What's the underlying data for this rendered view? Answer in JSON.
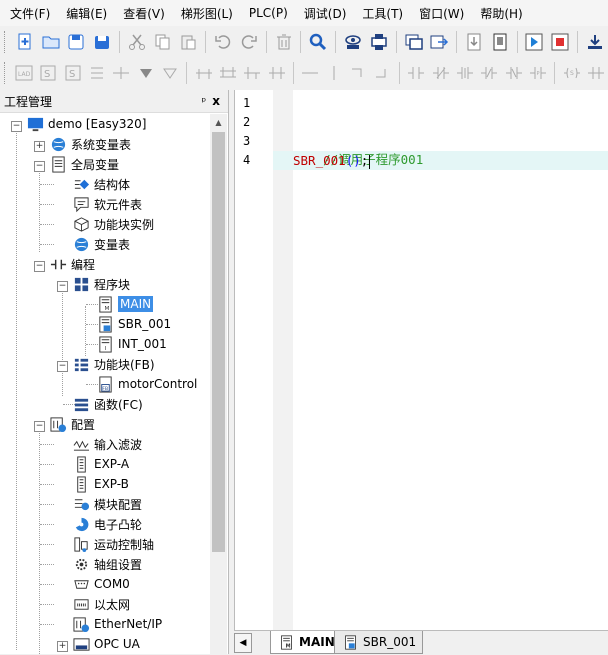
{
  "menu": [
    "文件(F)",
    "编辑(E)",
    "查看(V)",
    "梯形图(L)",
    "PLC(P)",
    "调试(D)",
    "工具(T)",
    "窗口(W)",
    "帮助(H)"
  ],
  "toolbar1": [
    "new-file-icon",
    "open-folder-icon",
    "save-icon",
    "save-all-icon",
    "cut-icon",
    "copy-icon",
    "paste-icon",
    "undo-icon",
    "redo-icon",
    "delete-icon",
    "find-icon",
    "monitor-icon",
    "compile-icon",
    "window-icon",
    "export-icon",
    "download-icon",
    "upload-icon",
    "run-icon",
    "stop-icon",
    "transfer-icon"
  ],
  "toolbar2": [
    "lad-icon",
    "stl-icon",
    "sfc-icon",
    "contact-icon",
    "coil-icon",
    "branch-icon",
    "ladder-elements-icon"
  ],
  "project_panel": {
    "title": "工程管理",
    "pin": "ᵖ",
    "close": "x",
    "tree": {
      "root": "demo [Easy320]",
      "system_vars": "系统变量表",
      "global_vars": "全局变量",
      "struct": "结构体",
      "soft_elements": "软元件表",
      "fb_instances": "功能块实例",
      "var_table": "变量表",
      "programming": "编程",
      "program_blocks": "程序块",
      "main": "MAIN",
      "sbr": "SBR_001",
      "int": "INT_001",
      "function_blocks": "功能块(FB)",
      "motor_control": "motorControl",
      "functions": "函数(FC)",
      "config": "配置",
      "input_filter": "输入滤波",
      "exp_a": "EXP-A",
      "exp_b": "EXP-B",
      "module_config": "模块配置",
      "cam": "电子凸轮",
      "motion_axis": "运动控制轴",
      "axis_group": "轴组设置",
      "com0": "COM0",
      "ethernet": "以太网",
      "ethernet_ip": "EtherNet/IP",
      "opc_ua": "OPC UA"
    }
  },
  "editor": {
    "line_numbers": [
      "1",
      "2",
      "3",
      "4"
    ],
    "comment": "//调用子程序001",
    "call_name": "SBR_001",
    "call_parens": "()",
    "call_end": ";"
  },
  "tabs": {
    "active": "MAIN",
    "inactive": "SBR_001"
  }
}
